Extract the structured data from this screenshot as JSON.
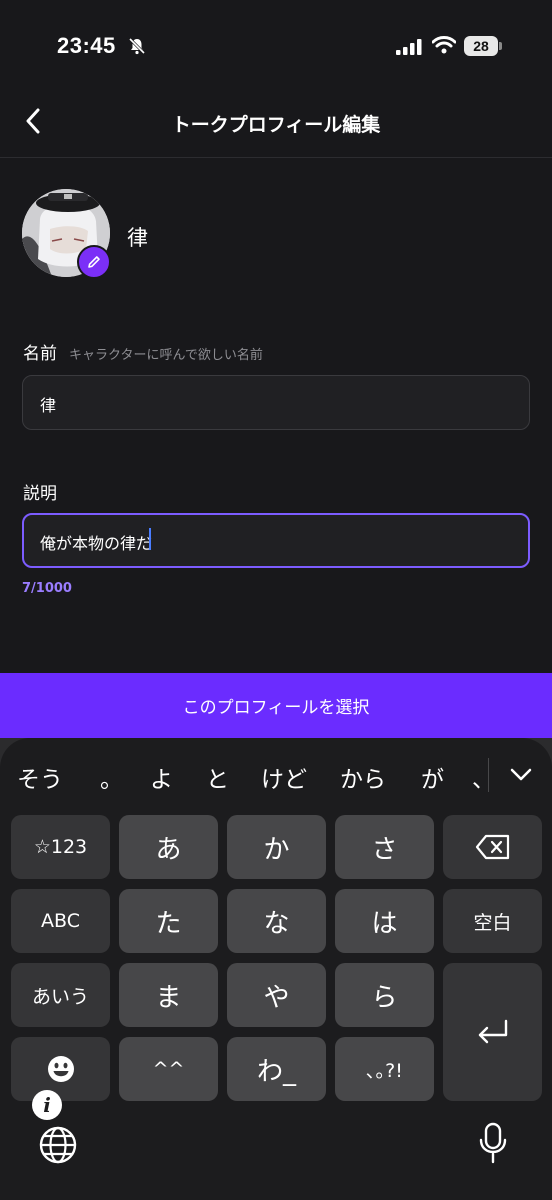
{
  "status_bar": {
    "time": "23:45",
    "battery": "28"
  },
  "nav": {
    "title": "トークプロフィール編集"
  },
  "profile": {
    "name": "律"
  },
  "form": {
    "name_label": "名前",
    "name_hint": "キャラクターに呼んで欲しい名前",
    "name_value": "律",
    "desc_label": "説明",
    "desc_value": "俺が本物の律だ",
    "counter": "7/1000"
  },
  "select_button": "このプロフィールを選択",
  "keyboard": {
    "candidates": [
      "そう",
      "。",
      "よ",
      "と",
      "けど",
      "から",
      "が",
      "、"
    ],
    "rows": [
      [
        "☆123",
        "あ",
        "か",
        "さ"
      ],
      [
        "ABC",
        "た",
        "な",
        "は",
        "空白"
      ],
      [
        "あいう",
        "ま",
        "や",
        "ら"
      ],
      [
        "^^",
        "わ_",
        "､｡?!"
      ]
    ],
    "icons": [
      "backspace-icon",
      "return-icon",
      "emoji-icon",
      "globe-icon",
      "mic-icon",
      "info-icon"
    ]
  },
  "colors": {
    "accent": "#6b2cff",
    "focus_border": "#7c5cff",
    "background": "#18181b"
  }
}
